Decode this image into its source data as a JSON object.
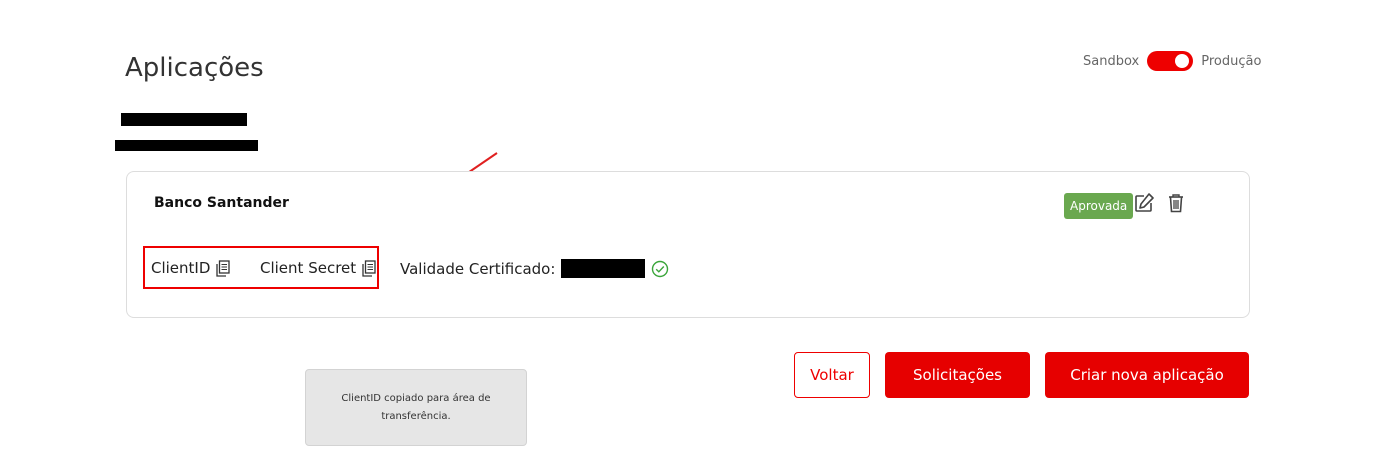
{
  "page": {
    "title": "Aplicações"
  },
  "environment": {
    "left_label": "Sandbox",
    "right_label": "Produção",
    "selected": "Produção",
    "accent_color": "#e00000"
  },
  "app_card": {
    "name": "Banco Santander",
    "status": "Aprovada",
    "status_color": "#6aa84f",
    "client_id_label": "ClientID",
    "client_secret_label": "Client Secret",
    "cert_label": "Validade Certificado:",
    "icons": [
      "copy-icon",
      "edit-icon",
      "trash-icon",
      "check-circle-icon"
    ]
  },
  "actions": {
    "back": "Voltar",
    "requests": "Solicitações",
    "create": "Criar nova aplicação"
  },
  "toast": {
    "message": "ClientID copiado para área de transferência."
  }
}
